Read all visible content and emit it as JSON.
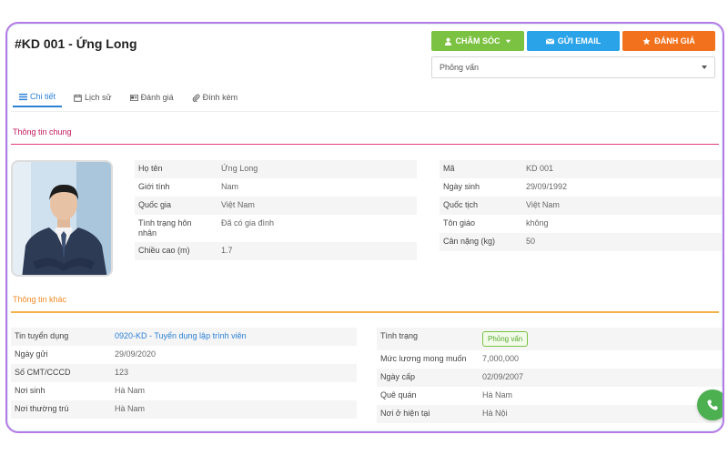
{
  "header": {
    "title": "#KD 001 - Ứng Long",
    "buttons": {
      "care_label": "CHĂM SÓC",
      "email_label": "GỬI EMAIL",
      "rate_label": "ĐÁNH GIÁ"
    },
    "status_select": {
      "value": "Phỏng vấn"
    }
  },
  "tabs": [
    {
      "label": "Chi tiết",
      "icon": "list-icon",
      "active": true
    },
    {
      "label": "Lịch sử",
      "icon": "calendar-icon"
    },
    {
      "label": "Đánh giá",
      "icon": "card-icon"
    },
    {
      "label": "Đính kèm",
      "icon": "paperclip-icon"
    }
  ],
  "sections": {
    "general": "Thông tin chung",
    "other": "Thông tin khác"
  },
  "general_left": [
    {
      "k": "Họ tên",
      "v": "Ứng Long"
    },
    {
      "k": "Giới tính",
      "v": "Nam"
    },
    {
      "k": "Quốc gia",
      "v": "Việt Nam"
    },
    {
      "k": "Tình trạng hôn nhân",
      "v": "Đã có gia đình"
    },
    {
      "k": "Chiều cao (m)",
      "v": "1.7"
    }
  ],
  "general_right": [
    {
      "k": "Mã",
      "v": "KD 001"
    },
    {
      "k": "Ngày sinh",
      "v": "29/09/1992"
    },
    {
      "k": "Quốc tịch",
      "v": "Việt Nam"
    },
    {
      "k": "Tôn giáo",
      "v": "không"
    },
    {
      "k": "Cân nặng (kg)",
      "v": "50"
    }
  ],
  "other_left": [
    {
      "k": "Tin tuyển dụng",
      "v": "0920-KD - Tuyển dụng lập trình viên"
    },
    {
      "k": "Ngày gửi",
      "v": "29/09/2020"
    },
    {
      "k": "Số CMT/CCCD",
      "v": "123"
    },
    {
      "k": "Nơi sinh",
      "v": "Hà Nam"
    },
    {
      "k": "Nơi thường trú",
      "v": "Hà Nam"
    }
  ],
  "other_right": [
    {
      "k": "Tình trạng",
      "v": "Phỏng vấn"
    },
    {
      "k": "Mức lương mong muốn",
      "v": "7,000,000"
    },
    {
      "k": "Ngày cấp",
      "v": "02/09/2007"
    },
    {
      "k": "Quê quán",
      "v": "Hà Nam"
    },
    {
      "k": "Nơi ở hiện tại",
      "v": "Hà Nội"
    }
  ],
  "colors": {
    "frame": "#b57ae6",
    "green": "#7cc242",
    "blue": "#2aa3e8",
    "orange": "#f2711c",
    "link": "#2b7fd6",
    "section1": "#c2185b",
    "section2": "#f08a24"
  }
}
